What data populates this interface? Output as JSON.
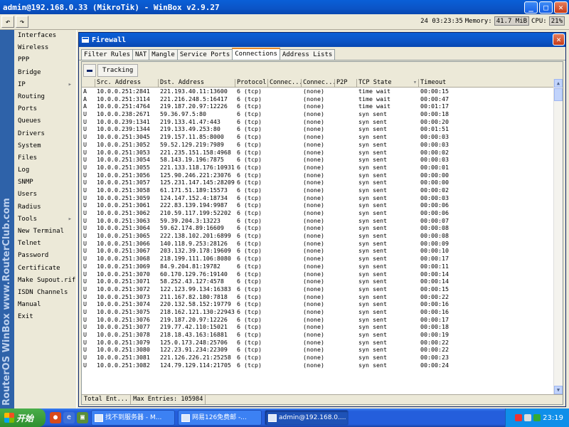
{
  "window": {
    "title": "admin@192.168.0.33 (MikroTik) - WinBox v2.9.27"
  },
  "toolbar": {
    "undo_glyph": "↶",
    "redo_glyph": "↷",
    "clock": "24 03:23:35",
    "memory_label": "Memory:",
    "memory_value": "41.7 MiB",
    "cpu_label": "CPU:",
    "cpu_value": "21%"
  },
  "sidestrip": {
    "text": "RouterOS WinBox  www.RouterClub.com"
  },
  "menu": {
    "items": [
      {
        "label": "Interfaces",
        "arrow": ""
      },
      {
        "label": "Wireless",
        "arrow": ""
      },
      {
        "label": "PPP",
        "arrow": ""
      },
      {
        "label": "Bridge",
        "arrow": ""
      },
      {
        "label": "IP",
        "arrow": "▸"
      },
      {
        "label": "Routing",
        "arrow": ""
      },
      {
        "label": "Ports",
        "arrow": ""
      },
      {
        "label": "Queues",
        "arrow": ""
      },
      {
        "label": "Drivers",
        "arrow": ""
      },
      {
        "label": "System",
        "arrow": ""
      },
      {
        "label": "Files",
        "arrow": ""
      },
      {
        "label": "Log",
        "arrow": ""
      },
      {
        "label": "SNMP",
        "arrow": ""
      },
      {
        "label": "Users",
        "arrow": ""
      },
      {
        "label": "Radius",
        "arrow": ""
      },
      {
        "label": "Tools",
        "arrow": "▸"
      },
      {
        "label": "New Terminal",
        "arrow": ""
      },
      {
        "label": "Telnet",
        "arrow": ""
      },
      {
        "label": "Password",
        "arrow": ""
      },
      {
        "label": "Certificate",
        "arrow": ""
      },
      {
        "label": "Make Supout.rif",
        "arrow": ""
      },
      {
        "label": "ISDN Channels",
        "arrow": ""
      },
      {
        "label": "Manual",
        "arrow": ""
      },
      {
        "label": "Exit",
        "arrow": ""
      }
    ]
  },
  "firewall": {
    "title": "Firewall",
    "close_glyph": "✕",
    "tabs": [
      "Filter Rules",
      "NAT",
      "Mangle",
      "Service Ports",
      "Connections",
      "Address Lists"
    ],
    "active_tab": "Connections",
    "tracking_label": "Tracking",
    "columns": [
      "",
      "Src. Address",
      "Dst. Address",
      "Protocol",
      "Connec...",
      "Connec...",
      "P2P",
      "TCP State",
      "Timeout"
    ],
    "rows": [
      [
        "A",
        "10.0.0.251:2841",
        "221.193.40.11:13600",
        "6 (tcp)",
        "",
        "(none)",
        "",
        "time wait",
        "00:00:15"
      ],
      [
        "A",
        "10.0.0.251:3114",
        "221.216.248.5:16417",
        "6 (tcp)",
        "",
        "(none)",
        "",
        "time wait",
        "00:00:47"
      ],
      [
        "A",
        "10.0.0.251:4764",
        "219.187.20.97:12226",
        "6 (tcp)",
        "",
        "(none)",
        "",
        "time wait",
        "00:01:17"
      ],
      [
        "U",
        "10.0.0.238:2671",
        "59.36.97.5:80",
        "6 (tcp)",
        "",
        "(none)",
        "",
        "syn sent",
        "00:00:18"
      ],
      [
        "U",
        "10.0.0.239:1341",
        "219.133.41.47:443",
        "6 (tcp)",
        "",
        "(none)",
        "",
        "syn sent",
        "00:00:20"
      ],
      [
        "U",
        "10.0.0.239:1344",
        "219.133.49.253:80",
        "6 (tcp)",
        "",
        "(none)",
        "",
        "syn sent",
        "00:01:51"
      ],
      [
        "U",
        "10.0.0.251:3045",
        "219.157.11.85:8000",
        "6 (tcp)",
        "",
        "(none)",
        "",
        "syn sent",
        "00:00:03"
      ],
      [
        "U",
        "10.0.0.251:3052",
        "59.52.129.219:7989",
        "6 (tcp)",
        "",
        "(none)",
        "",
        "syn sent",
        "00:00:03"
      ],
      [
        "U",
        "10.0.0.251:3053",
        "221.235.151.158:4968",
        "6 (tcp)",
        "",
        "(none)",
        "",
        "syn sent",
        "00:00:02"
      ],
      [
        "U",
        "10.0.0.251:3054",
        "58.143.19.196:7875",
        "6 (tcp)",
        "",
        "(none)",
        "",
        "syn sent",
        "00:00:03"
      ],
      [
        "U",
        "10.0.0.251:3055",
        "221.133.118.176:10931",
        "6 (tcp)",
        "",
        "(none)",
        "",
        "syn sent",
        "00:00:01"
      ],
      [
        "U",
        "10.0.0.251:3056",
        "125.90.246.221:23076",
        "6 (tcp)",
        "",
        "(none)",
        "",
        "syn sent",
        "00:00:00"
      ],
      [
        "U",
        "10.0.0.251:3057",
        "125.231.147.145:28209",
        "6 (tcp)",
        "",
        "(none)",
        "",
        "syn sent",
        "00:00:00"
      ],
      [
        "U",
        "10.0.0.251:3058",
        "61.171.51.189:15573",
        "6 (tcp)",
        "",
        "(none)",
        "",
        "syn sent",
        "00:00:02"
      ],
      [
        "U",
        "10.0.0.251:3059",
        "124.147.152.4:18734",
        "6 (tcp)",
        "",
        "(none)",
        "",
        "syn sent",
        "00:00:03"
      ],
      [
        "U",
        "10.0.0.251:3061",
        "222.83.139.194:9987",
        "6 (tcp)",
        "",
        "(none)",
        "",
        "syn sent",
        "00:00:06"
      ],
      [
        "U",
        "10.0.0.251:3062",
        "210.59.117.199:52202",
        "6 (tcp)",
        "",
        "(none)",
        "",
        "syn sent",
        "00:00:06"
      ],
      [
        "U",
        "10.0.0.251:3063",
        "59.39.204.3:13223",
        "6 (tcp)",
        "",
        "(none)",
        "",
        "syn sent",
        "00:00:07"
      ],
      [
        "U",
        "10.0.0.251:3064",
        "59.62.174.89:16609",
        "6 (tcp)",
        "",
        "(none)",
        "",
        "syn sent",
        "00:00:08"
      ],
      [
        "U",
        "10.0.0.251:3065",
        "222.138.102.201:6899",
        "6 (tcp)",
        "",
        "(none)",
        "",
        "syn sent",
        "00:00:08"
      ],
      [
        "U",
        "10.0.0.251:3066",
        "140.118.9.253:28126",
        "6 (tcp)",
        "",
        "(none)",
        "",
        "syn sent",
        "00:00:09"
      ],
      [
        "U",
        "10.0.0.251:3067",
        "203.132.39.178:19609",
        "6 (tcp)",
        "",
        "(none)",
        "",
        "syn sent",
        "00:00:10"
      ],
      [
        "U",
        "10.0.0.251:3068",
        "218.199.111.106:8080",
        "6 (tcp)",
        "",
        "(none)",
        "",
        "syn sent",
        "00:00:17"
      ],
      [
        "U",
        "10.0.0.251:3069",
        "84.9.204.81:19782",
        "6 (tcp)",
        "",
        "(none)",
        "",
        "syn sent",
        "00:00:11"
      ],
      [
        "U",
        "10.0.0.251:3070",
        "60.170.129.76:19140",
        "6 (tcp)",
        "",
        "(none)",
        "",
        "syn sent",
        "00:00:14"
      ],
      [
        "U",
        "10.0.0.251:3071",
        "58.252.43.127:4578",
        "6 (tcp)",
        "",
        "(none)",
        "",
        "syn sent",
        "00:00:14"
      ],
      [
        "U",
        "10.0.0.251:3072",
        "122.123.99.134:16383",
        "6 (tcp)",
        "",
        "(none)",
        "",
        "syn sent",
        "00:00:15"
      ],
      [
        "U",
        "10.0.0.251:3073",
        "211.167.82.180:7818",
        "6 (tcp)",
        "",
        "(none)",
        "",
        "syn sent",
        "00:00:22"
      ],
      [
        "U",
        "10.0.0.251:3074",
        "220.132.58.152:19779",
        "6 (tcp)",
        "",
        "(none)",
        "",
        "syn sent",
        "00:00:16"
      ],
      [
        "U",
        "10.0.0.251:3075",
        "218.162.121.130:22943",
        "6 (tcp)",
        "",
        "(none)",
        "",
        "syn sent",
        "00:00:16"
      ],
      [
        "U",
        "10.0.0.251:3076",
        "219.187.20.97:12226",
        "6 (tcp)",
        "",
        "(none)",
        "",
        "syn sent",
        "00:00:17"
      ],
      [
        "U",
        "10.0.0.251:3077",
        "219.77.42.110:15021",
        "6 (tcp)",
        "",
        "(none)",
        "",
        "syn sent",
        "00:00:18"
      ],
      [
        "U",
        "10.0.0.251:3078",
        "218.18.43.163:16881",
        "6 (tcp)",
        "",
        "(none)",
        "",
        "syn sent",
        "00:00:19"
      ],
      [
        "U",
        "10.0.0.251:3079",
        "125.0.173.248:25706",
        "6 (tcp)",
        "",
        "(none)",
        "",
        "syn sent",
        "00:00:22"
      ],
      [
        "U",
        "10.0.0.251:3080",
        "122.23.91.234:22309",
        "6 (tcp)",
        "",
        "(none)",
        "",
        "syn sent",
        "00:00:22"
      ],
      [
        "U",
        "10.0.0.251:3081",
        "221.126.226.21:25258",
        "6 (tcp)",
        "",
        "(none)",
        "",
        "syn sent",
        "00:00:23"
      ],
      [
        "U",
        "10.0.0.251:3082",
        "124.79.129.114:21705",
        "6 (tcp)",
        "",
        "(none)",
        "",
        "syn sent",
        "00:00:24"
      ]
    ],
    "footer_total": "Total Ent...",
    "footer_max": "Max Entries: 105984"
  },
  "taskbar": {
    "start_label": "开始",
    "tasks": [
      {
        "label": "找不到服务器 - M...",
        "active": false
      },
      {
        "label": "网易126免费邮 -...",
        "active": false
      },
      {
        "label": "admin@192.168.0....",
        "active": true
      }
    ],
    "clock": "23:19"
  },
  "colors": {
    "titlebar": "#0B54C6",
    "tab_highlight": "#E68B2C",
    "taskbar": "#245EDC"
  }
}
